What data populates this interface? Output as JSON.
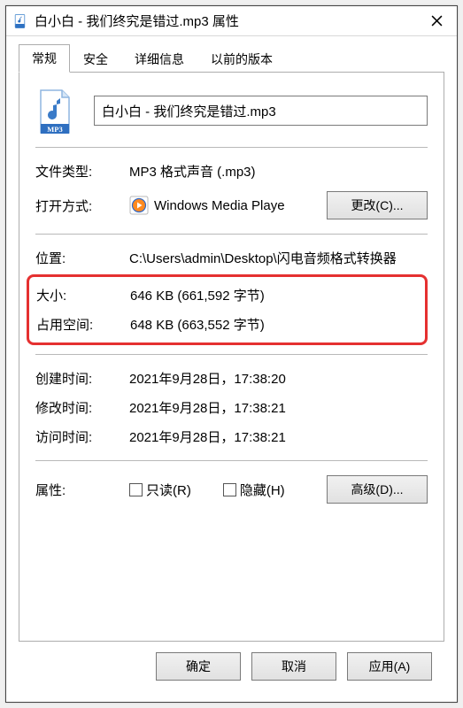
{
  "titlebar": {
    "title": "白小白 - 我们终究是错过.mp3 属性"
  },
  "tabs": {
    "general": "常规",
    "security": "安全",
    "details": "详细信息",
    "previous": "以前的版本"
  },
  "filename": "白小白 - 我们终究是错过.mp3",
  "labels": {
    "filetype": "文件类型:",
    "openwith": "打开方式:",
    "location": "位置:",
    "size": "大小:",
    "sizeondisk": "占用空间:",
    "created": "创建时间:",
    "modified": "修改时间:",
    "accessed": "访问时间:",
    "attributes": "属性:"
  },
  "values": {
    "filetype": "MP3 格式声音 (.mp3)",
    "openwith": "Windows Media Playe",
    "location": "C:\\Users\\admin\\Desktop\\闪电音频格式转换器",
    "size": "646 KB (661,592 字节)",
    "sizeondisk": "648 KB (663,552 字节)",
    "created": "2021年9月28日，17:38:20",
    "modified": "2021年9月28日，17:38:21",
    "accessed": "2021年9月28日，17:38:21"
  },
  "buttons": {
    "change": "更改(C)...",
    "advanced": "高级(D)...",
    "ok": "确定",
    "cancel": "取消",
    "apply": "应用(A)"
  },
  "checkboxes": {
    "readonly": "只读(R)",
    "hidden": "隐藏(H)"
  }
}
